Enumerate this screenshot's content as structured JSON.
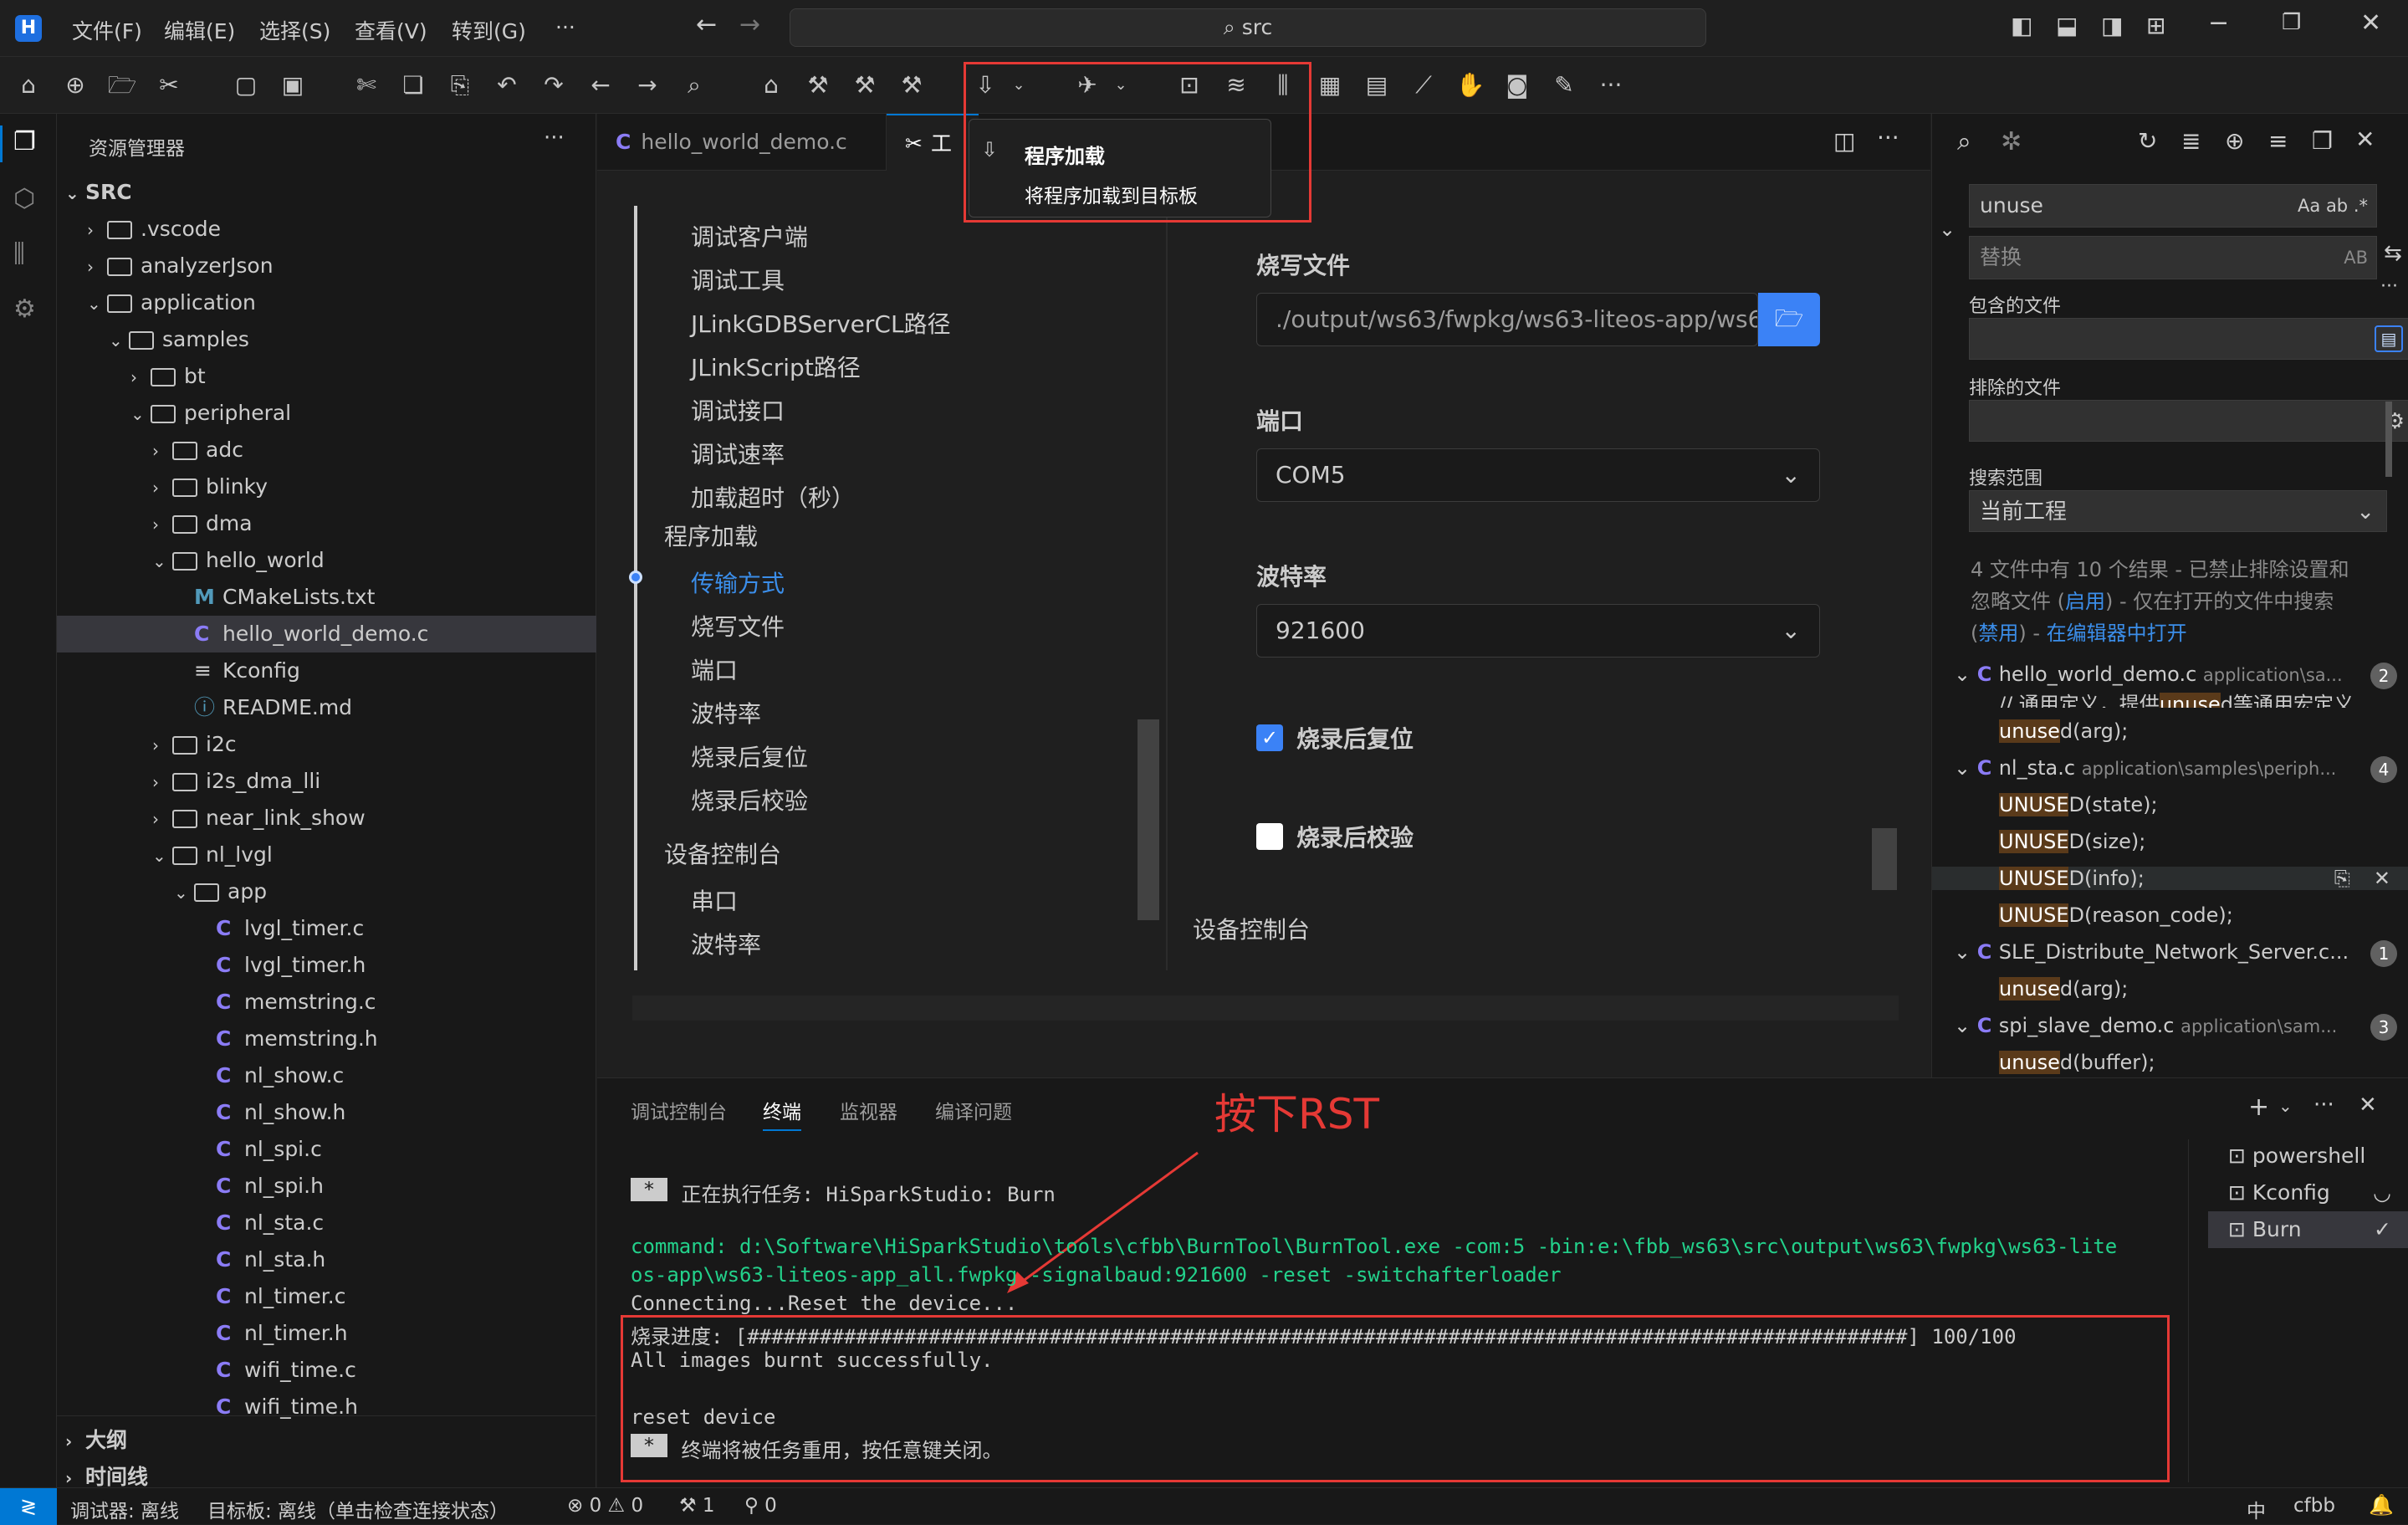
{
  "menu": {
    "file": "文件(F)",
    "edit": "编辑(E)",
    "select": "选择(S)",
    "view": "查看(V)",
    "goto": "转到(G)",
    "more": "···"
  },
  "search": {
    "text": "src"
  },
  "explorer": {
    "title": "资源管理器",
    "root": "SRC",
    "items": [
      ".vscode",
      "analyzerJson",
      "application",
      "samples",
      "bt",
      "peripheral",
      "adc",
      "blinky",
      "dma",
      "hello_world",
      "CMakeLists.txt",
      "hello_world_demo.c",
      "Kconfig",
      "README.md",
      "i2c",
      "i2s_dma_lli",
      "near_link_show",
      "nl_lvgl",
      "app",
      "lvgl_timer.c",
      "lvgl_timer.h",
      "memstring.c",
      "memstring.h",
      "nl_show.c",
      "nl_show.h",
      "nl_spi.c",
      "nl_spi.h",
      "nl_sta.c",
      "nl_sta.h",
      "nl_timer.c",
      "nl_timer.h",
      "wifi_time.c",
      "wifi_time.h"
    ],
    "outline": "大纲",
    "timeline": "时间线"
  },
  "tabs": {
    "tab1": "hello_world_demo.c",
    "tab2": "工"
  },
  "tooltip": {
    "title": "程序加载",
    "desc": "将程序加载到目标板"
  },
  "nav": {
    "items": [
      "调试客户端",
      "调试工具",
      "JLinkGDBServerCL路径",
      "JLinkScript路径",
      "调试接口",
      "调试速率",
      "加载超时（秒）"
    ],
    "group1": "程序加载",
    "group1_items": [
      "传输方式",
      "烧写文件",
      "端口",
      "波特率",
      "烧录后复位",
      "烧录后校验"
    ],
    "group2": "设备控制台",
    "group2_items": [
      "串口",
      "波特率"
    ]
  },
  "form": {
    "burn_file_label": "烧写文件",
    "burn_file_value": "./output/ws63/fwpkg/ws63-liteos-app/ws6",
    "port_label": "端口",
    "port_value": "COM5",
    "baud_label": "波特率",
    "baud_value": "921600",
    "reset_label": "烧录后复位",
    "verify_label": "烧录后校验",
    "console_label": "设备控制台"
  },
  "searchpanel": {
    "find": "unuse",
    "find_opts": "Aa  ab  .*",
    "replace": "替换",
    "replace_opt": "AB",
    "include": "包含的文件",
    "exclude": "排除的文件",
    "scope_label": "搜索范围",
    "scope": "当前工程",
    "summary1": "4 文件中有 10 个结果 - 已禁止排除设置和",
    "summary2": "忽略文件 (",
    "enable": "启用",
    "summary3": ") - 仅在打开的文件中搜索",
    "disable": "禁用",
    "summary4": ") - ",
    "open_in_editor": "在编辑器中打开",
    "files": [
      {
        "name": "hello_world_demo.c",
        "path": "application\\sa...",
        "count": "2"
      },
      {
        "name": "nl_sta.c",
        "path": "application\\samples\\periph...",
        "count": "4"
      },
      {
        "name": "SLE_Distribute_Network_Server.c...",
        "path": "",
        "count": "1"
      },
      {
        "name": "spi_slave_demo.c",
        "path": "application\\sam...",
        "count": "3"
      }
    ],
    "lines": {
      "l0a": "// 通用定义，提供",
      "l0b": "unuse",
      "l0c": "d等通用宏定义",
      "l1a": "unuse",
      "l1b": "d(arg);",
      "l2a": "UNUSE",
      "l2b": "D(state);",
      "l3a": "UNUSE",
      "l3b": "D(size);",
      "l4a": "UNUSE",
      "l4b": "D(info);",
      "l5a": "UNUSE",
      "l5b": "D(reason_code);",
      "l6a": "unuse",
      "l6b": "d(arg);",
      "l7a": "unuse",
      "l7b": "d(buffer);"
    }
  },
  "terminal": {
    "tabs": [
      "调试控制台",
      "终端",
      "监视器",
      "编译问题"
    ],
    "annotation": "按下RST",
    "star": "*",
    "task": " 正在执行任务: HiSparkStudio: Burn",
    "cmd1": "command: d:\\Software\\HiSparkStudio\\tools\\cfbb\\BurnTool\\BurnTool.exe -com:5 -bin:e:\\fbb_ws63\\src\\output\\ws63\\fwpkg\\ws63-lite",
    "cmd2": "os-app\\ws63-liteos-app_all.fwpkg -signalbaud:921600 -reset -switchafterloader",
    "connecting": "Connecting...Reset the device...",
    "progress": "烧录进度: [################################################################################################] 100/100",
    "burnt": "All images burnt successfully.",
    "reset": "reset device",
    "reuse": " 终端将被任务重用，按任意键关闭。",
    "sessions": [
      "powershell",
      "Kconfig",
      "Burn"
    ]
  },
  "status": {
    "debugger": "调试器: 离线",
    "target": "目标板:  离线（单击检查连接状态）",
    "errors": "⊗ 0 ⚠ 0",
    "tools": "⚒ 1",
    "ports": "⚲ 0",
    "lang": "中",
    "enc": "cfbb"
  }
}
